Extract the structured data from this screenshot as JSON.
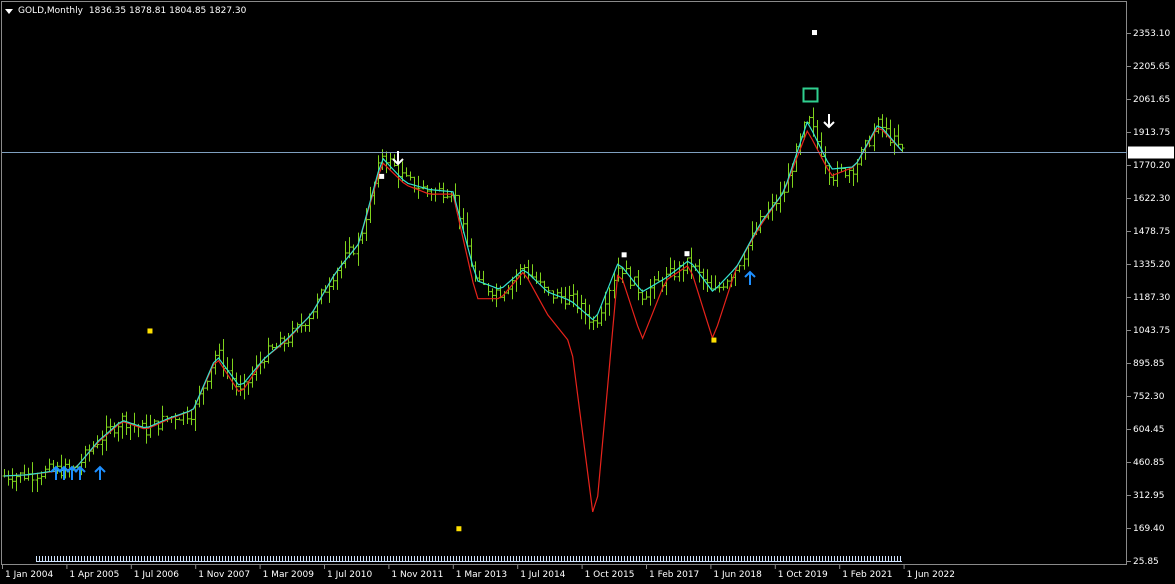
{
  "header": {
    "symbol": "GOLD,Monthly",
    "ohlc": "1836.35 1878.81 1804.85 1827.30"
  },
  "price_axis": {
    "labels": [
      "2353.10",
      "2205.65",
      "2061.65",
      "1913.75",
      "1770.20",
      "1622.30",
      "1478.75",
      "1335.20",
      "1187.30",
      "1043.75",
      "895.85",
      "752.30",
      "604.45",
      "460.85",
      "312.95",
      "169.40",
      "25.85"
    ],
    "current_price": "1827.30"
  },
  "time_axis": {
    "labels": [
      "1 Jan 2004",
      "1 Apr 2005",
      "1 Jul 2006",
      "1 Nov 2007",
      "1 Mar 2009",
      "1 Jul 2010",
      "1 Nov 2011",
      "1 Mar 2013",
      "1 Jul 2014",
      "1 Oct 2015",
      "1 Feb 2017",
      "1 Jun 2018",
      "1 Oct 2019",
      "1 Feb 2021",
      "1 Jun 2022"
    ]
  },
  "colors": {
    "background": "#000000",
    "bars": "#7fd31c",
    "cyan_line": "#34e3d0",
    "red_line": "#e8231b",
    "current_price_line": "#7f9fbf",
    "up_arrow": "#1e8fff",
    "down_arrow": "#ffffff",
    "marker_yellow": "#ffe000",
    "marker_white": "#ffffff",
    "highlight_box": "#2fcf8f",
    "histogram": "#cfe4ff"
  },
  "chart_data": {
    "type": "ohlc",
    "symbol": "GOLD",
    "timeframe": "Monthly",
    "ylim": [
      25.85,
      2353.1
    ],
    "last": 1827.3,
    "x": [
      "2004-01",
      "2004-07",
      "2005-01",
      "2005-07",
      "2006-01",
      "2006-05",
      "2006-10",
      "2007-03",
      "2007-08",
      "2008-03",
      "2008-10",
      "2009-03",
      "2009-09",
      "2010-03",
      "2010-09",
      "2011-03",
      "2011-08",
      "2012-02",
      "2012-08",
      "2013-01",
      "2013-06",
      "2013-12",
      "2014-06",
      "2014-12",
      "2015-06",
      "2015-12",
      "2016-07",
      "2017-01",
      "2017-07",
      "2018-01",
      "2018-08",
      "2019-01",
      "2019-08",
      "2020-03",
      "2020-08",
      "2021-03",
      "2021-09",
      "2022-03",
      "2022-06"
    ],
    "close": [
      400,
      405,
      425,
      430,
      560,
      650,
      600,
      660,
      680,
      950,
      760,
      930,
      1000,
      1120,
      1300,
      1430,
      1820,
      1700,
      1650,
      1660,
      1240,
      1210,
      1320,
      1200,
      1180,
      1070,
      1330,
      1200,
      1270,
      1340,
      1200,
      1320,
      1520,
      1650,
      1970,
      1720,
      1760,
      1950,
      1827.3
    ],
    "cyan_line": [
      400,
      405,
      420,
      430,
      555,
      645,
      610,
      655,
      690,
      930,
      790,
      915,
      1005,
      1110,
      1290,
      1420,
      1800,
      1690,
      1660,
      1650,
      1260,
      1220,
      1310,
      1210,
      1170,
      1080,
      1340,
      1210,
      1270,
      1350,
      1210,
      1320,
      1510,
      1650,
      1960,
      1750,
      1760,
      1950,
      1830
    ],
    "red_line": [
      400,
      405,
      418,
      432,
      550,
      640,
      605,
      650,
      690,
      920,
      760,
      915,
      1000,
      1110,
      1290,
      1420,
      1780,
      1680,
      1640,
      1640,
      1180,
      1180,
      1300,
      1110,
      980,
      170,
      1320,
      1000,
      1260,
      1330,
      1000,
      1320,
      1500,
      1650,
      1920,
      1720,
      1760,
      1940,
      1830
    ]
  }
}
